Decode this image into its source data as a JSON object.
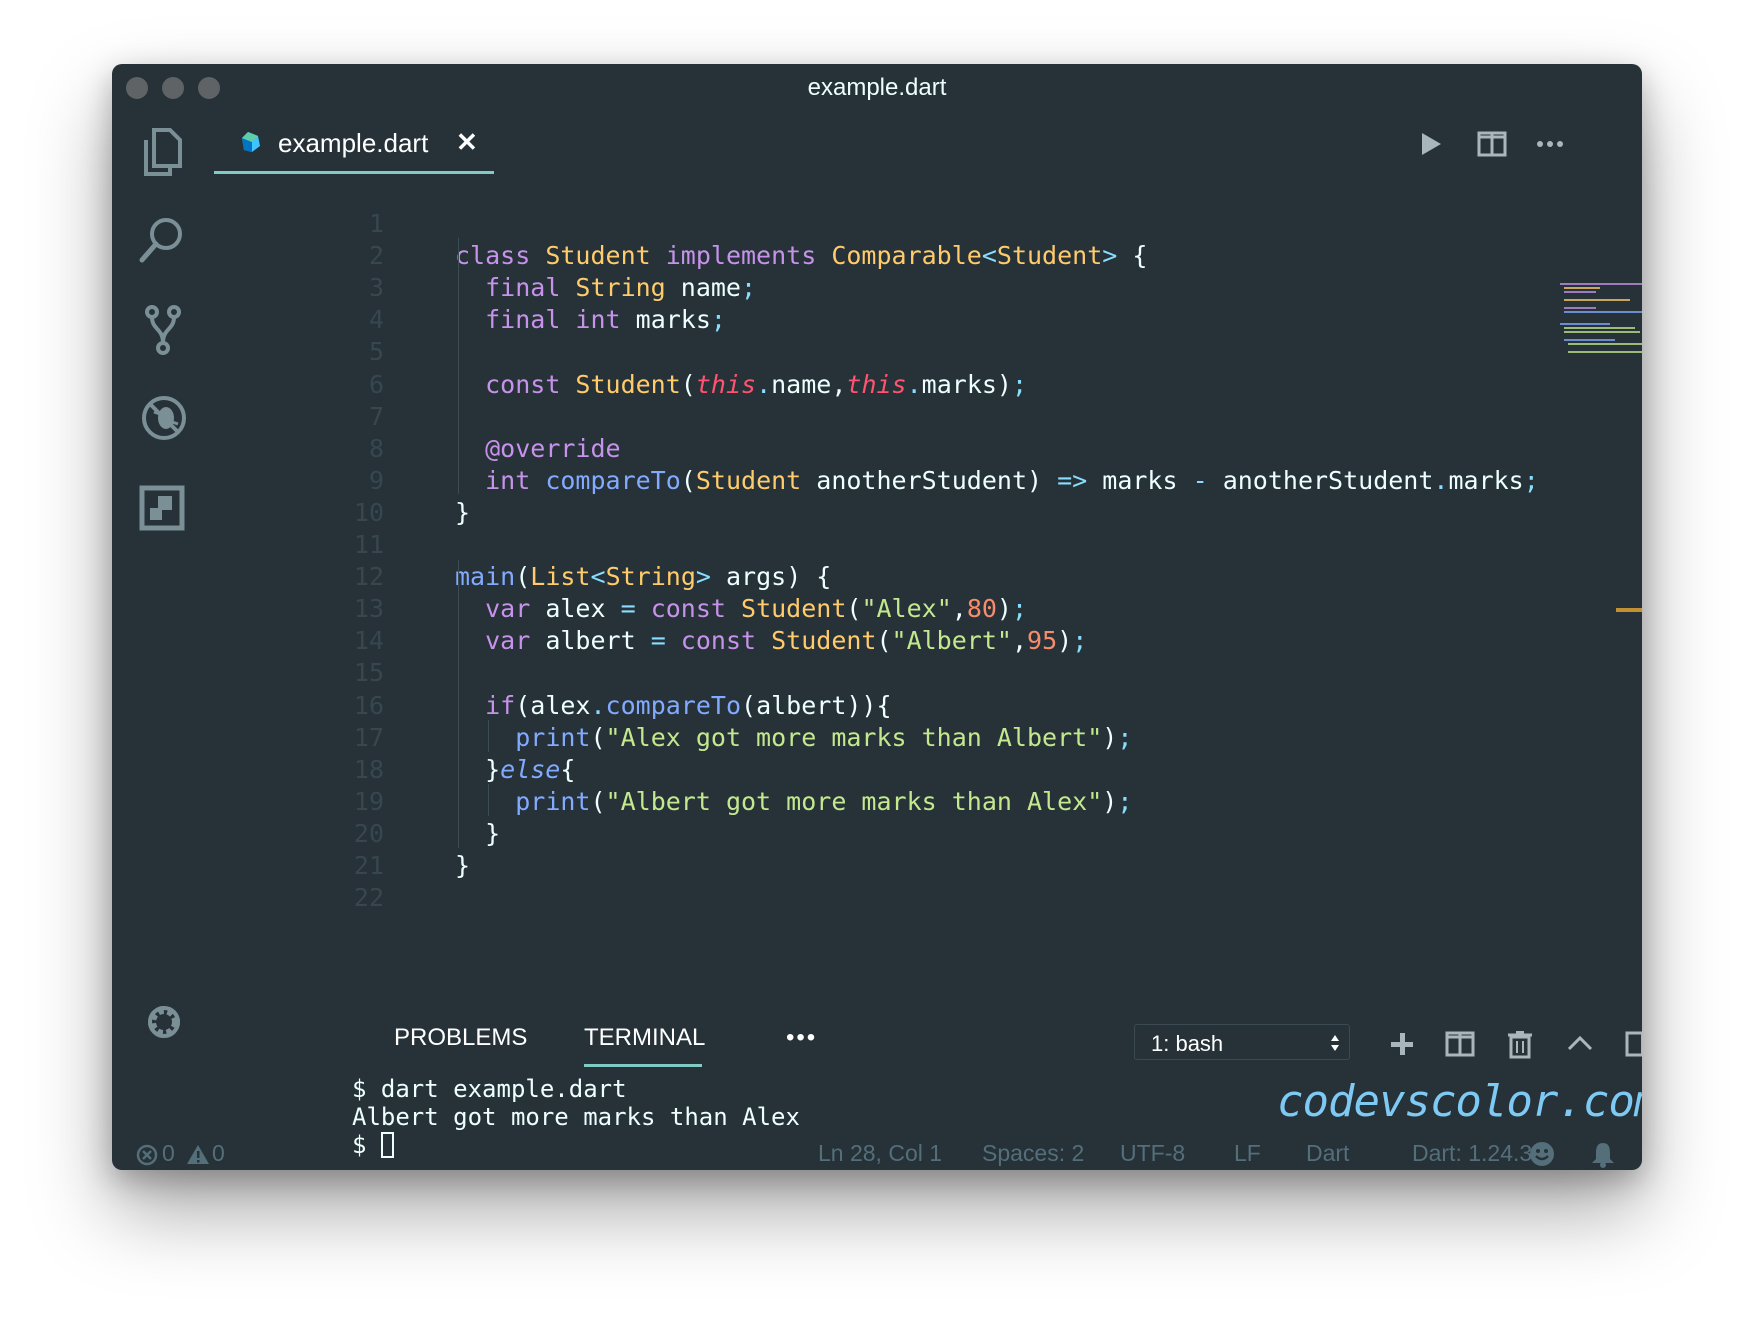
{
  "window": {
    "title": "example.dart"
  },
  "activity_bar": {
    "icons": [
      "explorer-icon",
      "search-icon",
      "source-control-icon",
      "debug-icon",
      "extensions-icon",
      "gear-icon"
    ]
  },
  "editor": {
    "tab": {
      "label": "example.dart",
      "close": "✕"
    },
    "toolbar_icons": [
      "run-icon",
      "split-editor-icon",
      "more-icon"
    ],
    "lines": [
      {
        "num": "1"
      },
      {
        "num": "2",
        "tokens": [
          {
            "c": "k",
            "v": "class "
          },
          {
            "c": "t",
            "v": "Student "
          },
          {
            "c": "k",
            "v": "implements "
          },
          {
            "c": "t",
            "v": "Comparable"
          },
          {
            "c": "p",
            "v": "<"
          },
          {
            "c": "t",
            "v": "Student"
          },
          {
            "c": "p",
            "v": ">"
          },
          {
            "c": "",
            "v": " {"
          }
        ]
      },
      {
        "num": "3",
        "tokens": [
          {
            "c": "",
            "v": "  "
          },
          {
            "c": "k",
            "v": "final "
          },
          {
            "c": "t",
            "v": "String "
          },
          {
            "c": "",
            "v": "name"
          },
          {
            "c": "p",
            "v": ";"
          }
        ]
      },
      {
        "num": "4",
        "tokens": [
          {
            "c": "",
            "v": "  "
          },
          {
            "c": "k",
            "v": "final "
          },
          {
            "c": "k",
            "v": "int "
          },
          {
            "c": "",
            "v": "marks"
          },
          {
            "c": "p",
            "v": ";"
          }
        ]
      },
      {
        "num": "5"
      },
      {
        "num": "6",
        "tokens": [
          {
            "c": "",
            "v": "  "
          },
          {
            "c": "k",
            "v": "const "
          },
          {
            "c": "t",
            "v": "Student"
          },
          {
            "c": "",
            "v": "("
          },
          {
            "c": "th",
            "v": "this"
          },
          {
            "c": "p",
            "v": "."
          },
          {
            "c": "",
            "v": "name,"
          },
          {
            "c": "th",
            "v": "this"
          },
          {
            "c": "p",
            "v": "."
          },
          {
            "c": "",
            "v": "marks)"
          },
          {
            "c": "p",
            "v": ";"
          }
        ]
      },
      {
        "num": "7"
      },
      {
        "num": "8",
        "tokens": [
          {
            "c": "",
            "v": "  "
          },
          {
            "c": "k",
            "v": "@override"
          }
        ]
      },
      {
        "num": "9",
        "tokens": [
          {
            "c": "",
            "v": "  "
          },
          {
            "c": "k",
            "v": "int "
          },
          {
            "c": "f",
            "v": "compareTo"
          },
          {
            "c": "",
            "v": "("
          },
          {
            "c": "t",
            "v": "Student "
          },
          {
            "c": "",
            "v": "anotherStudent) "
          },
          {
            "c": "p",
            "v": "=> "
          },
          {
            "c": "",
            "v": "marks "
          },
          {
            "c": "p",
            "v": "- "
          },
          {
            "c": "",
            "v": "anotherStudent"
          },
          {
            "c": "p",
            "v": "."
          },
          {
            "c": "",
            "v": "marks"
          },
          {
            "c": "p",
            "v": ";"
          }
        ]
      },
      {
        "num": "10",
        "tokens": [
          {
            "c": "",
            "v": "}"
          }
        ]
      },
      {
        "num": "11"
      },
      {
        "num": "12",
        "tokens": [
          {
            "c": "f",
            "v": "main"
          },
          {
            "c": "",
            "v": "("
          },
          {
            "c": "t",
            "v": "List"
          },
          {
            "c": "p",
            "v": "<"
          },
          {
            "c": "t",
            "v": "String"
          },
          {
            "c": "p",
            "v": ">"
          },
          {
            "c": "",
            "v": " args) {"
          }
        ]
      },
      {
        "num": "13",
        "tokens": [
          {
            "c": "",
            "v": "  "
          },
          {
            "c": "k",
            "v": "var "
          },
          {
            "c": "",
            "v": "alex "
          },
          {
            "c": "p",
            "v": "= "
          },
          {
            "c": "k",
            "v": "const "
          },
          {
            "c": "t",
            "v": "Student"
          },
          {
            "c": "",
            "v": "("
          },
          {
            "c": "s",
            "v": "\"Alex\""
          },
          {
            "c": "",
            "v": ","
          },
          {
            "c": "n",
            "v": "80"
          },
          {
            "c": "",
            "v": ")"
          },
          {
            "c": "p",
            "v": ";"
          }
        ]
      },
      {
        "num": "14",
        "tokens": [
          {
            "c": "",
            "v": "  "
          },
          {
            "c": "k",
            "v": "var "
          },
          {
            "c": "",
            "v": "albert "
          },
          {
            "c": "p",
            "v": "= "
          },
          {
            "c": "k",
            "v": "const "
          },
          {
            "c": "t",
            "v": "Student"
          },
          {
            "c": "",
            "v": "("
          },
          {
            "c": "s",
            "v": "\"Albert\""
          },
          {
            "c": "",
            "v": ","
          },
          {
            "c": "n",
            "v": "95"
          },
          {
            "c": "",
            "v": ")"
          },
          {
            "c": "p",
            "v": ";"
          }
        ]
      },
      {
        "num": "15"
      },
      {
        "num": "16",
        "tokens": [
          {
            "c": "",
            "v": "  "
          },
          {
            "c": "k",
            "v": "if"
          },
          {
            "c": "",
            "v": "(alex"
          },
          {
            "c": "p",
            "v": "."
          },
          {
            "c": "f",
            "v": "compareTo"
          },
          {
            "c": "",
            "v": "(albert)){"
          }
        ]
      },
      {
        "num": "17",
        "tokens": [
          {
            "c": "",
            "v": "    "
          },
          {
            "c": "f",
            "v": "print"
          },
          {
            "c": "",
            "v": "("
          },
          {
            "c": "s",
            "v": "\"Alex got more marks than Albert\""
          },
          {
            "c": "",
            "v": ")"
          },
          {
            "c": "p",
            "v": ";"
          }
        ]
      },
      {
        "num": "18",
        "tokens": [
          {
            "c": "",
            "v": "  }"
          },
          {
            "c": "it",
            "v": "else"
          },
          {
            "c": "",
            "v": "{"
          }
        ]
      },
      {
        "num": "19",
        "tokens": [
          {
            "c": "",
            "v": "    "
          },
          {
            "c": "f",
            "v": "print"
          },
          {
            "c": "",
            "v": "("
          },
          {
            "c": "s",
            "v": "\"Albert got more marks than Alex\""
          },
          {
            "c": "",
            "v": ")"
          },
          {
            "c": "p",
            "v": ";"
          }
        ]
      },
      {
        "num": "20",
        "tokens": [
          {
            "c": "",
            "v": "  }"
          }
        ]
      },
      {
        "num": "21",
        "tokens": [
          {
            "c": "",
            "v": "}"
          }
        ]
      },
      {
        "num": "22"
      }
    ]
  },
  "panel": {
    "tabs": [
      {
        "label": "PROBLEMS",
        "active": false
      },
      {
        "label": "TERMINAL",
        "active": true
      }
    ],
    "more": "•••",
    "terminal_select": "1: bash",
    "action_icons": [
      "add-icon",
      "split-terminal-icon",
      "trash-icon",
      "chevron-up-icon",
      "panel-layout-icon",
      "close-icon"
    ],
    "terminal_lines": [
      "$ dart example.dart",
      "Albert got more marks than Alex",
      "$ "
    ]
  },
  "watermark": "codevscolor.com",
  "statusbar": {
    "errors": "0",
    "warnings": "0",
    "position": "Ln 28, Col 1",
    "spaces": "Spaces: 2",
    "encoding": "UTF-8",
    "eol": "LF",
    "language": "Dart",
    "sdk": "Dart: 1.24.3"
  },
  "colors": {
    "background": "#263238",
    "accent": "#80cbc4",
    "keyword": "#c792ea",
    "type": "#ffcb6b",
    "function": "#82aaff",
    "string": "#c3e88d",
    "number": "#f78c6c",
    "this": "#ff5370"
  }
}
